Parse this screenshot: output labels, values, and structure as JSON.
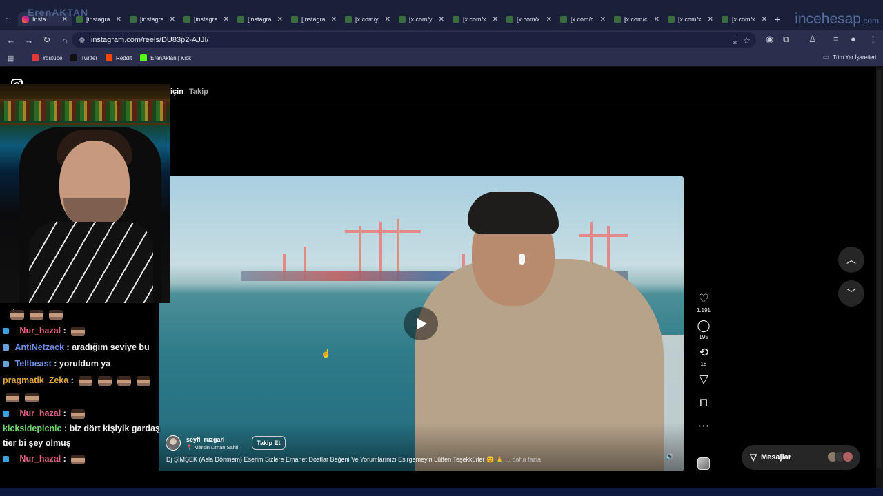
{
  "browser": {
    "tabs": [
      {
        "title": "Insta",
        "active": true,
        "icon": "instagram-icon"
      },
      {
        "title": "[instagra",
        "active": false,
        "icon": "folder-icon"
      },
      {
        "title": "[instagra",
        "active": false,
        "icon": "folder-icon"
      },
      {
        "title": "[instagra",
        "active": false,
        "icon": "folder-icon"
      },
      {
        "title": "[instagra",
        "active": false,
        "icon": "folder-icon"
      },
      {
        "title": "[instagra",
        "active": false,
        "icon": "folder-icon"
      },
      {
        "title": "[x.com/y",
        "active": false,
        "icon": "folder-icon"
      },
      {
        "title": "[x.com/y",
        "active": false,
        "icon": "folder-icon"
      },
      {
        "title": "[x.com/x",
        "active": false,
        "icon": "folder-icon"
      },
      {
        "title": "[x.com/x",
        "active": false,
        "icon": "folder-icon"
      },
      {
        "title": "[x.com/c",
        "active": false,
        "icon": "folder-icon"
      },
      {
        "title": "[x.com/c",
        "active": false,
        "icon": "folder-icon"
      },
      {
        "title": "[x.com/x",
        "active": false,
        "icon": "folder-icon"
      },
      {
        "title": "[x.com/x",
        "active": false,
        "icon": "folder-icon"
      }
    ],
    "watermark_left": "ErenAKTAN",
    "watermark_right_main": "incehesap",
    "watermark_right_suffix": ".com",
    "url": "instagram.com/reels/DU83p2-AJJI/",
    "bookmarks": [
      {
        "label": "Youtube",
        "color": "#e53935"
      },
      {
        "label": "Twitter",
        "color": "#111111"
      },
      {
        "label": "Reddit",
        "color": "#ff4500"
      },
      {
        "label": "ErenAktan | Kick",
        "color": "#53fc18"
      }
    ],
    "bookmarks_folder": "Tüm Yer İşaretleri"
  },
  "instagram": {
    "feed_tabs": {
      "for_you": "Senin için",
      "following": "Takip"
    },
    "reel": {
      "username": "seyfi_ruzgarl",
      "location": "Mersin Liman Sahil",
      "follow_label": "Takip Et",
      "caption": "Dj ŞİMŞEK (Asla Dönmem) Eserim Sizlere Emanet Dostlar Beğeni Ve Yorumlarınızı Esirgemeyin Lütfen Teşekkürler 😊 🙏",
      "more_label": "... daha fazla"
    },
    "actions": {
      "likes": "1.191",
      "comments": "195",
      "reposts": "18"
    },
    "messages_label": "Mesajlar"
  },
  "chat": [
    {
      "user": "Nur_hazal",
      "text": "",
      "color": "#e45c8a"
    },
    {
      "user": "AntiNetzack",
      "text": "aradığım seviye bu",
      "color": "#6c8fe8"
    },
    {
      "user": "Tellbeast",
      "text": "yoruldum ya",
      "color": "#6c8fe8"
    },
    {
      "user": "pragmatik_Zeka",
      "text": "",
      "color": "#e1a23a"
    },
    {
      "user": "Nur_hazal",
      "text": "",
      "color": "#e45c8a"
    },
    {
      "user": "kicksidepicnic",
      "text": "biz dört kişiyik gardaş tier bi şey olmuş",
      "color": "#6dd36a"
    },
    {
      "user": "Nur_hazal",
      "text": "",
      "color": "#e45c8a"
    }
  ]
}
